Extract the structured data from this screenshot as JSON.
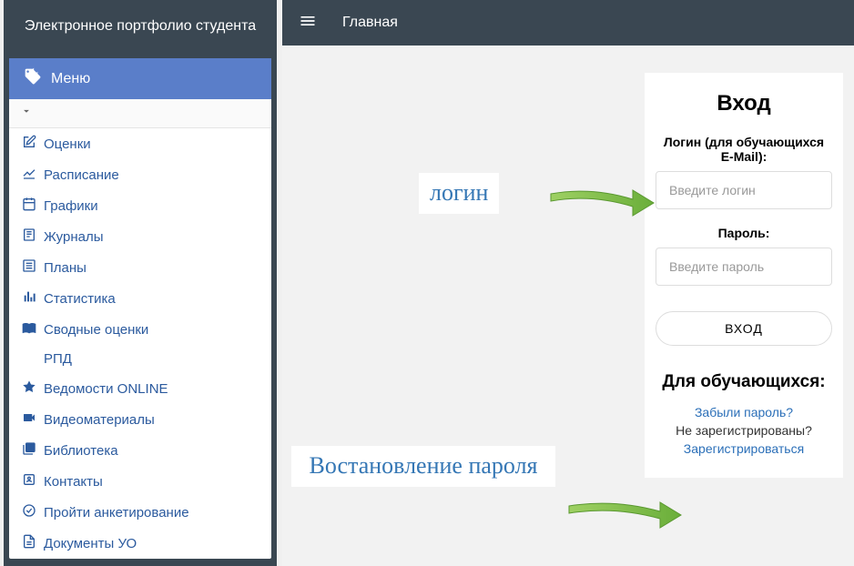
{
  "sidebar": {
    "title": "Электронное портфолио студента",
    "menu_label": "Меню",
    "items": [
      {
        "label": "Оценки",
        "icon": "edit-icon"
      },
      {
        "label": "Расписание",
        "icon": "chart-icon"
      },
      {
        "label": "Графики",
        "icon": "calendar-icon"
      },
      {
        "label": "Журналы",
        "icon": "book-icon"
      },
      {
        "label": "Планы",
        "icon": "list-icon"
      },
      {
        "label": "Статистика",
        "icon": "stats-icon"
      },
      {
        "label": "Сводные оценки",
        "icon": "open-book-icon"
      },
      {
        "label": "РПД",
        "icon": ""
      },
      {
        "label": "Ведомости ONLINE",
        "icon": "star-icon"
      },
      {
        "label": "Видеоматериалы",
        "icon": "video-icon"
      },
      {
        "label": "Библиотека",
        "icon": "library-icon"
      },
      {
        "label": "Контакты",
        "icon": "contacts-icon"
      },
      {
        "label": "Пройти анкетирование",
        "icon": "check-icon"
      },
      {
        "label": "Документы УО",
        "icon": "document-icon"
      }
    ]
  },
  "topbar": {
    "title": "Главная"
  },
  "login": {
    "heading": "Вход",
    "login_label": "Логин (для обучающихся E-Mail):",
    "login_placeholder": "Введите логин",
    "password_label": "Пароль:",
    "password_placeholder": "Введите пароль",
    "submit": "ВХОД",
    "students_heading": "Для обучающихся:",
    "forgot": "Забыли пароль?",
    "not_registered": "Не зарегистрированы?",
    "register": "Зарегистрироваться"
  },
  "annotations": {
    "login": "логин",
    "password": "Востановление пароля"
  },
  "colors": {
    "sidebar_bg": "#3a4752",
    "menu_header": "#5a7ec9",
    "link": "#2b5a9e",
    "annotation": "#3577b5",
    "arrow": "#76c042"
  }
}
